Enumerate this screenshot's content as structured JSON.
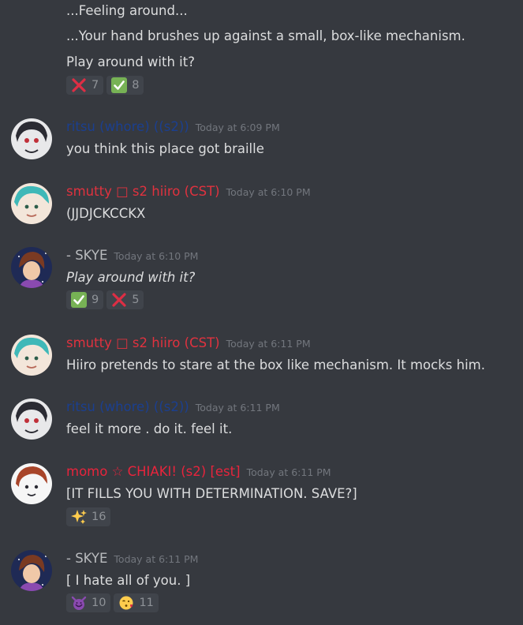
{
  "colors": {
    "background": "#36393f",
    "ritsu": "#1b3f8f",
    "smutty": "#e0323f",
    "skye": "#b9bbbe",
    "momo": "#e8243c",
    "timestamp": "#72767d"
  },
  "messages": {
    "m0": {
      "lines": [
        "...Feeling around...",
        "...Your hand brushes up against a small, box-like mechanism.",
        "Play around with it?"
      ],
      "reactions": [
        {
          "emoji": "cross-mark",
          "count": "7"
        },
        {
          "emoji": "check-mark",
          "count": "8"
        }
      ]
    },
    "m1": {
      "username": "ritsu (whore) ((s2))",
      "timestamp": "Today at 6:09 PM",
      "text": "you think this place got braille"
    },
    "m2": {
      "username": "smutty □ s2 hiiro (CST)",
      "timestamp": "Today at 6:10 PM",
      "text": "(JJDJCKCCKX"
    },
    "m3": {
      "username": "- SKYE",
      "timestamp": "Today at 6:10 PM",
      "text": "Play around with it?",
      "reactions": [
        {
          "emoji": "check-mark",
          "count": "9"
        },
        {
          "emoji": "cross-mark",
          "count": "5"
        }
      ]
    },
    "m4": {
      "username": "smutty □ s2 hiiro (CST)",
      "timestamp": "Today at 6:11 PM",
      "text": "Hiiro pretends to stare at the box like mechanism. It mocks him."
    },
    "m5": {
      "username": "ritsu (whore) ((s2))",
      "timestamp": "Today at 6:11 PM",
      "text": "feel it more . do it. feel it."
    },
    "m6": {
      "username": "momo ☆ CHIAKI! (s2) [est]",
      "timestamp": "Today at 6:11 PM",
      "text": "[IT FILLS YOU WITH DETERMINATION. SAVE?]",
      "reactions": [
        {
          "emoji": "sparkles",
          "count": "16"
        }
      ]
    },
    "m7": {
      "username": "- SKYE",
      "timestamp": "Today at 6:11 PM",
      "text": "[ I hate all of you. ]",
      "reactions": [
        {
          "emoji": "smiling-imp",
          "count": "10"
        },
        {
          "emoji": "kissing-heart",
          "count": "11"
        }
      ]
    }
  }
}
